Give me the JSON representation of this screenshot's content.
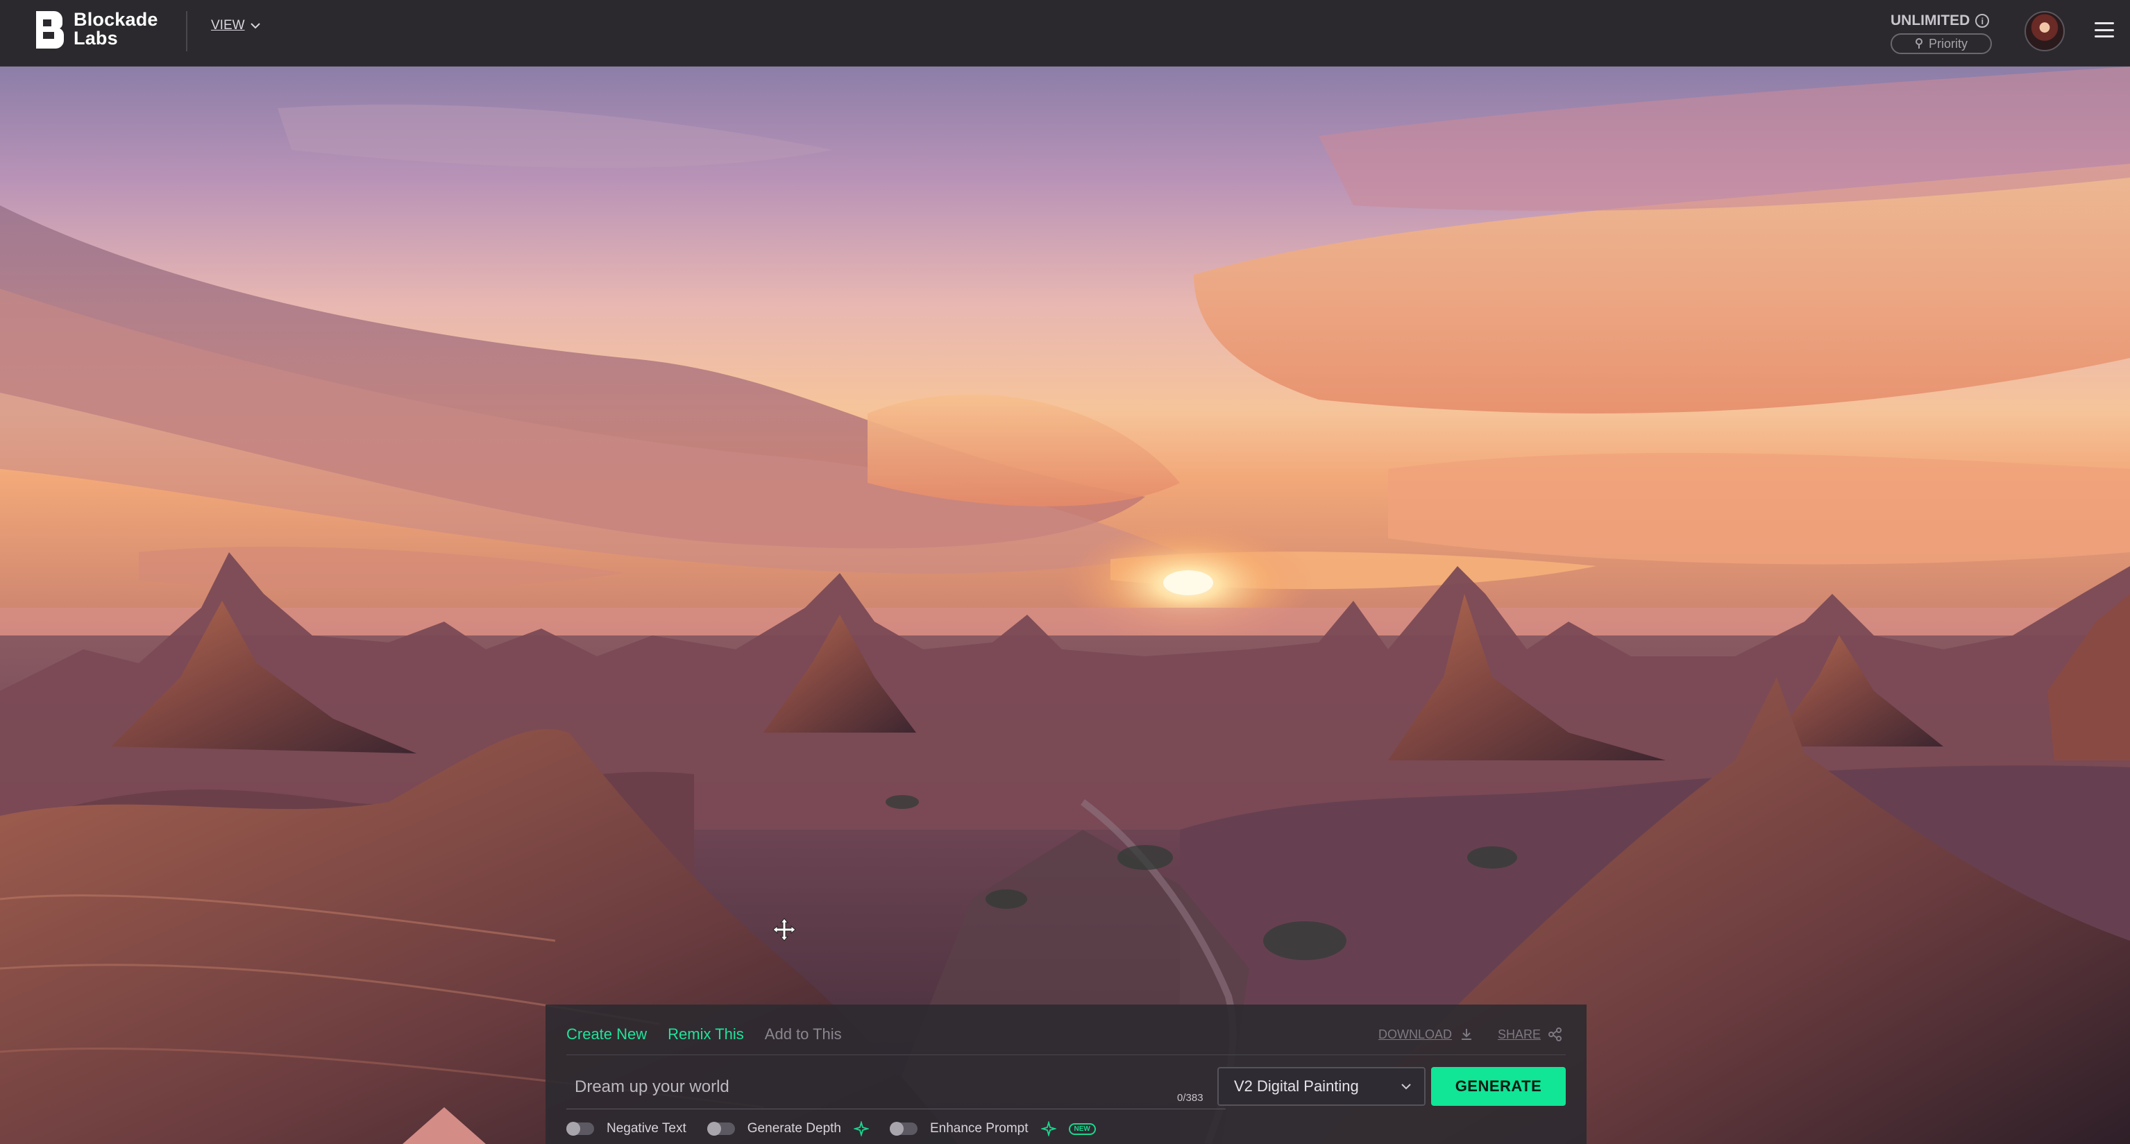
{
  "header": {
    "logo_line1": "Blockade",
    "logo_line2": "Labs",
    "view_label": "VIEW",
    "plan_label": "UNLIMITED",
    "priority_label": "Priority"
  },
  "panel": {
    "tabs": [
      {
        "label": "Create New",
        "state": "active"
      },
      {
        "label": "Remix This",
        "state": "active"
      },
      {
        "label": "Add to This",
        "state": "disabled"
      }
    ],
    "download_label": "DOWNLOAD",
    "share_label": "SHARE",
    "prompt_placeholder": "Dream up your world",
    "prompt_value": "",
    "char_counter": "0/383",
    "style_selected": "V2 Digital Painting",
    "generate_label": "GENERATE",
    "toggles": [
      {
        "label": "Negative Text",
        "on": false
      },
      {
        "label": "Generate Depth",
        "on": false
      },
      {
        "label": "Enhance Prompt",
        "on": false
      }
    ],
    "new_badge": "NEW"
  },
  "colors": {
    "accent": "#11e596",
    "header_bg": "#2b292d",
    "panel_bg": "#2c2a30"
  },
  "icons": [
    "logo-mark",
    "chevron-down-icon",
    "info-icon",
    "pin-icon",
    "avatar",
    "hamburger-icon",
    "download-icon",
    "share-icon",
    "sparkle-icon",
    "move-cursor-icon"
  ]
}
